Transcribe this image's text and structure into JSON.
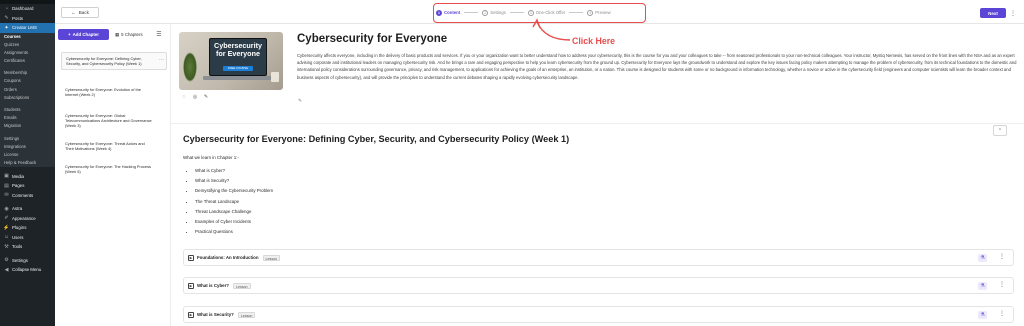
{
  "wp_menu": {
    "items_top": [
      {
        "label": "Dashboard",
        "icon": "dashboard-icon",
        "glyph": "◔"
      },
      {
        "label": "Posts",
        "icon": "pin-icon",
        "glyph": "✎"
      },
      {
        "label": "Creator LMS",
        "icon": "lms-icon",
        "glyph": "✦"
      }
    ],
    "lms_sub": [
      "Courses",
      "Quizzes",
      "Assignments",
      "Certificates",
      "",
      "Membership",
      "Coupons",
      "Orders",
      "Subscriptions",
      "",
      "Students",
      "Emails",
      "Migration",
      "",
      "Settings",
      "Integrations",
      "License",
      "Help & Feedback"
    ],
    "items_bottom": [
      {
        "label": "Media",
        "icon": "media-icon",
        "glyph": "▣"
      },
      {
        "label": "Pages",
        "icon": "pages-icon",
        "glyph": "▤"
      },
      {
        "label": "Comments",
        "icon": "comments-icon",
        "glyph": "✉"
      },
      {
        "label": "Astra",
        "icon": "astra-icon",
        "glyph": "◉"
      },
      {
        "label": "Appearance",
        "icon": "brush-icon",
        "glyph": "✐"
      },
      {
        "label": "Plugins",
        "icon": "plugin-icon",
        "glyph": "⚡"
      },
      {
        "label": "Users",
        "icon": "users-icon",
        "glyph": "☺"
      },
      {
        "label": "Tools",
        "icon": "tools-icon",
        "glyph": "⚒"
      },
      {
        "label": "Settings",
        "icon": "settings-icon",
        "glyph": "⚙"
      },
      {
        "label": "Collapse Menu",
        "icon": "collapse-icon",
        "glyph": "◀"
      }
    ]
  },
  "topbar": {
    "back_label": "Back",
    "back_glyph": "←",
    "steps": [
      {
        "num": "1",
        "label": "Content"
      },
      {
        "num": "2",
        "label": "Settings"
      },
      {
        "num": "3",
        "label": "One-Click Offer"
      },
      {
        "num": "4",
        "label": "Preview"
      }
    ],
    "next_label": "Next",
    "more_glyph": "⋮",
    "accent": "#5b45d6"
  },
  "chapter_panel": {
    "add_label": "Add Chapter",
    "add_glyph": "+",
    "count_label": "5 Chapters",
    "count_glyph": "▦",
    "collapse_glyph": "☰",
    "chapters": [
      "Cybersecurity for Everyone: Defining Cyber, Security, and Cybersecurity Policy (Week 1)",
      "Cybersecurity for Everyone: Evolution of the Internet (Week 2)",
      "Cybersecurity for Everyone: Global Telecommunications Architecture and Governance (Week 3)",
      "Cybersecurity for Everyone: Threat Actors and Their Motivations (Week 4)",
      "Cybersecurity for Everyone: The Hacking Process (Week 5)"
    ],
    "menu_glyph": "⋯"
  },
  "course": {
    "title": "Cybersecurity for Everyone",
    "thumb_text_line1": "Cybersecurity",
    "thumb_text_line2": "for Everyone",
    "thumb_badge": "FREE COURSE",
    "description": "Cybersecurity affects everyone, including in the delivery of basic products and services. If you or your organization want to better understand how to address your cybersecurity, this is the course for you and your colleagues to take -- from seasoned professionals to your non-technical colleagues. Your instructor, Mystiq Nemesis, has served on the front lines with the NSA and as an expert advising corporate and institutional leaders on managing cybersecurity risk. And he brings a rare and engaging perspective to help you learn cybersecurity from the ground up. Cybersecurity for Everyone lays the groundwork to understand and explore the key issues facing policy makers attempting to manage the problem of cybersecurity, from its technical foundations to the domestic and international policy considerations surrounding governance, privacy, and risk management, to applications for achieving the goals of an enterprise, an institution, or a nation. This course is designed for students with some or no background in information technology, whether a novice or active in the cybersecurity field (engineers and computer scientists will learn the broader context and business aspects of cybersecurity), and will provide the principles to understand the current debates shaping a rapidly evolving cybersecurity landscape.",
    "mini_icons": [
      "◌",
      "◎",
      "✎"
    ],
    "edit_glyph": "✎"
  },
  "chapter_detail": {
    "title": "Cybersecurity for Everyone:  Defining Cyber, Security, and Cybersecurity Policy (Week 1)",
    "intro": "What we learn in Chapter 1:-",
    "learn_items": [
      "What is Cyber?",
      "What is Security?",
      "Demystifying the Cybersecurity Problem",
      "The Threat Landscape",
      "Threat Landscape Challenge",
      "Examples of Cyber Incidents",
      "Practical Questions"
    ],
    "collapse_glyph": "⌃",
    "lessons": [
      {
        "title": "Foundations: An Introduction",
        "tag": "Lesson"
      },
      {
        "title": "What is Cyber?",
        "tag": "Lesson"
      },
      {
        "title": "What is Security?",
        "tag": "Lesson"
      }
    ],
    "lesson_action_glyph": "⚗",
    "lesson_more_glyph": "⋮"
  },
  "annotation": {
    "label": "Click Here",
    "color": "#e84c4c"
  }
}
